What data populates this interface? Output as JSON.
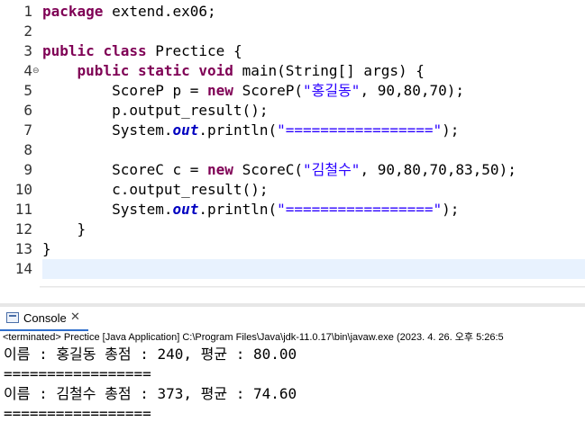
{
  "editor": {
    "lines": [
      {
        "n": "1",
        "tokens": [
          [
            "kw",
            "package"
          ],
          [
            "t",
            " extend.ex06;"
          ]
        ]
      },
      {
        "n": "2",
        "tokens": []
      },
      {
        "n": "3",
        "tokens": [
          [
            "kw",
            "public"
          ],
          [
            "t",
            " "
          ],
          [
            "kw",
            "class"
          ],
          [
            "t",
            " Prectice {"
          ]
        ]
      },
      {
        "n": "4",
        "fold": "⊖",
        "tokens": [
          [
            "t",
            "    "
          ],
          [
            "kw",
            "public"
          ],
          [
            "t",
            " "
          ],
          [
            "kw",
            "static"
          ],
          [
            "t",
            " "
          ],
          [
            "kw",
            "void"
          ],
          [
            "t",
            " main(String[] args) {"
          ]
        ]
      },
      {
        "n": "5",
        "tokens": [
          [
            "t",
            "        ScoreP p = "
          ],
          [
            "kw",
            "new"
          ],
          [
            "t",
            " ScoreP("
          ],
          [
            "str",
            "\"홍길동\""
          ],
          [
            "t",
            ", 90,80,70);"
          ]
        ]
      },
      {
        "n": "6",
        "tokens": [
          [
            "t",
            "        p.output_result();"
          ]
        ]
      },
      {
        "n": "7",
        "tokens": [
          [
            "t",
            "        System."
          ],
          [
            "fld",
            "out"
          ],
          [
            "t",
            ".println("
          ],
          [
            "str",
            "\"=================\""
          ],
          [
            "t",
            ");"
          ]
        ]
      },
      {
        "n": "8",
        "tokens": []
      },
      {
        "n": "9",
        "tokens": [
          [
            "t",
            "        ScoreC c = "
          ],
          [
            "kw",
            "new"
          ],
          [
            "t",
            " ScoreC("
          ],
          [
            "str",
            "\"김철수\""
          ],
          [
            "t",
            ", 90,80,70,83,50);"
          ]
        ]
      },
      {
        "n": "10",
        "tokens": [
          [
            "t",
            "        c.output_result();"
          ]
        ]
      },
      {
        "n": "11",
        "tokens": [
          [
            "t",
            "        System."
          ],
          [
            "fld",
            "out"
          ],
          [
            "t",
            ".println("
          ],
          [
            "str",
            "\"=================\""
          ],
          [
            "t",
            ");"
          ]
        ]
      },
      {
        "n": "12",
        "tokens": [
          [
            "t",
            "    }"
          ]
        ]
      },
      {
        "n": "13",
        "tokens": [
          [
            "t",
            "}"
          ]
        ]
      },
      {
        "n": "14",
        "current": true,
        "tokens": []
      }
    ]
  },
  "scrollbar": {
    "left_arrow": "<"
  },
  "console": {
    "title": "Console",
    "close_glyph": "✕",
    "status": "<terminated> Prectice [Java Application] C:\\Program Files\\Java\\jdk-11.0.17\\bin\\javaw.exe  (2023. 4. 26. 오후 5:26:5",
    "output": [
      "이름 : 홍길동 총점 : 240, 평균 : 80.00",
      "=================",
      "이름 : 김철수 총점 : 373, 평균 : 74.60",
      "================="
    ]
  },
  "colors": {
    "keyword": "#7f0055",
    "string": "#2a00ff",
    "static_field": "#0000c0",
    "current_line": "#e8f2fe",
    "tab_accent": "#2f6fcc"
  }
}
